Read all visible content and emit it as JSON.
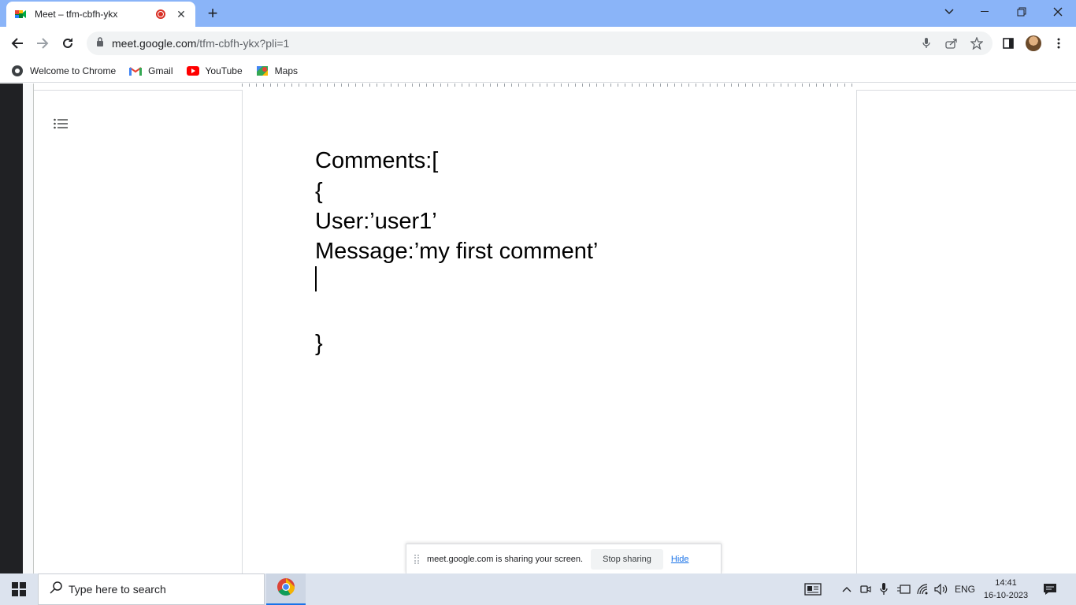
{
  "browser": {
    "tab": {
      "title": "Meet – tfm-cbfh-ykx"
    },
    "address": {
      "domain": "meet.google.com",
      "path": "/tfm-cbfh-ykx?pli=1"
    },
    "bookmarks": [
      {
        "label": "Welcome to Chrome",
        "icon": "chrome-globe-icon"
      },
      {
        "label": "Gmail",
        "icon": "gmail-icon"
      },
      {
        "label": "YouTube",
        "icon": "youtube-icon"
      },
      {
        "label": "Maps",
        "icon": "maps-icon"
      }
    ]
  },
  "document": {
    "lines": [
      "Comments:[",
      "{",
      "User:’user1’",
      "Message:’my first comment’",
      "}"
    ]
  },
  "sharing_bar": {
    "message": "meet.google.com is sharing your screen.",
    "stop_label": "Stop sharing",
    "hide_label": "Hide"
  },
  "taskbar": {
    "search_placeholder": "Type here to search",
    "language": "ENG",
    "time": "14:41",
    "date": "16-10-2023"
  },
  "colors": {
    "tabstrip": "#8ab4f8",
    "taskbar": "#dce3ee",
    "link": "#1a73e8"
  }
}
